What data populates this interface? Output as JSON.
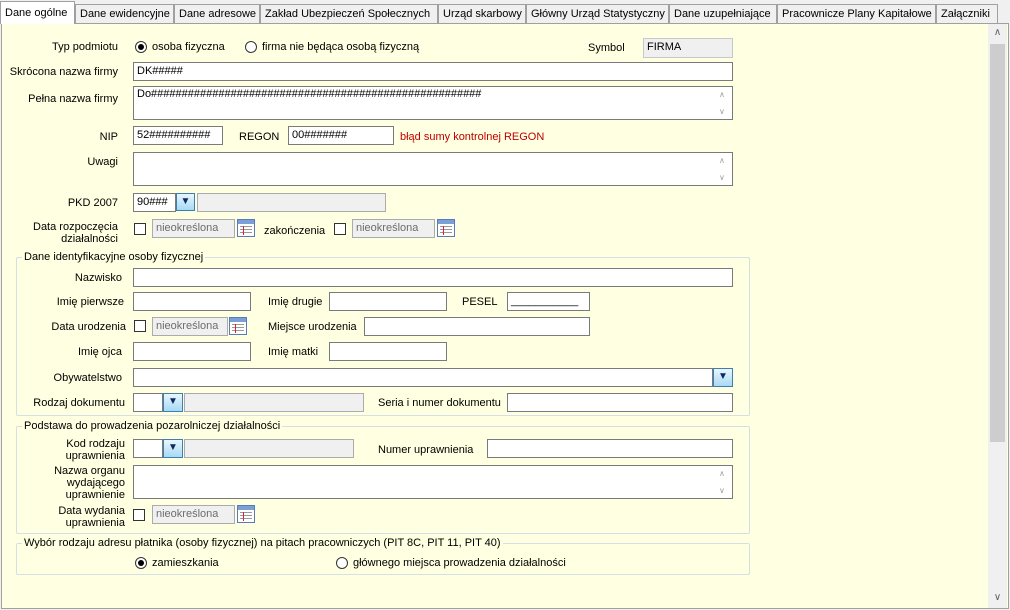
{
  "tabs": [
    "Dane ogólne",
    "Dane ewidencyjne",
    "Dane adresowe",
    "Zakład Ubezpieczeń Społecznych",
    "Urząd skarbowy",
    "Główny Urząd Statystyczny",
    "Dane uzupełniające",
    "Pracownicze Plany Kapitałowe",
    "Załączniki"
  ],
  "general": {
    "typ_label": "Typ podmiotu",
    "radio_osoba": "osoba fizyczna",
    "radio_firma": "firma nie będąca osobą fizyczną",
    "selected_type": "osoba fizyczna",
    "symbol_label": "Symbol",
    "symbol_value": "FIRMA",
    "short_name_label": "Skrócona nazwa firmy",
    "short_name_value": "DK#####",
    "full_name_label": "Pełna nazwa firmy",
    "full_name_value": "Do######################################################",
    "nip_label": "NIP",
    "nip_value": "52##########",
    "regon_label": "REGON",
    "regon_value": "00#######",
    "regon_error": "błąd sumy kontrolnej REGON",
    "uwagi_label": "Uwagi",
    "uwagi_value": "",
    "pkd_label": "PKD 2007",
    "pkd_value": "90###",
    "date_start_label_1": "Data rozpoczęcia",
    "date_start_label_2": "działalności",
    "date_start_value": "nieokreślona",
    "date_end_label": "zakończenia",
    "date_end_value": "nieokreślona"
  },
  "person": {
    "legend": "Dane identyfikacyjne osoby fizycznej",
    "surname_label": "Nazwisko",
    "first_name_label": "Imię pierwsze",
    "second_name_label": "Imię drugie",
    "pesel_label": "PESEL",
    "pesel_value": "___________",
    "birth_date_label": "Data urodzenia",
    "birth_date_value": "nieokreślona",
    "birth_place_label": "Miejsce urodzenia",
    "father_label": "Imię ojca",
    "mother_label": "Imię matki",
    "citizenship_label": "Obywatelstwo",
    "doc_type_label": "Rodzaj dokumentu",
    "doc_number_label": "Seria i numer dokumentu"
  },
  "basis": {
    "legend": "Podstawa do prowadzenia pozarolniczej działalności",
    "kod_label_1": "Kod rodzaju",
    "kod_label_2": "uprawnienia",
    "numer_label": "Numer uprawnienia",
    "organ_label_1": "Nazwa organu",
    "organ_label_2": "wydającego",
    "organ_label_3": "uprawnienie",
    "issue_label_1": "Data wydania",
    "issue_label_2": "uprawnienia",
    "issue_value": "nieokreślona"
  },
  "address_choice": {
    "legend": "Wybór rodzaju adresu płatnika (osoby fizycznej) na pitach pracowniczych (PIT 8C, PIT 11, PIT 40)",
    "opt1": "zamieszkania",
    "opt2": "głównego miejsca prowadzenia działalności",
    "selected": "zamieszkania"
  },
  "colors": {
    "panel_bg": "#ffffe1",
    "error": "#c00000",
    "dropdown": "#a7d9f5"
  }
}
